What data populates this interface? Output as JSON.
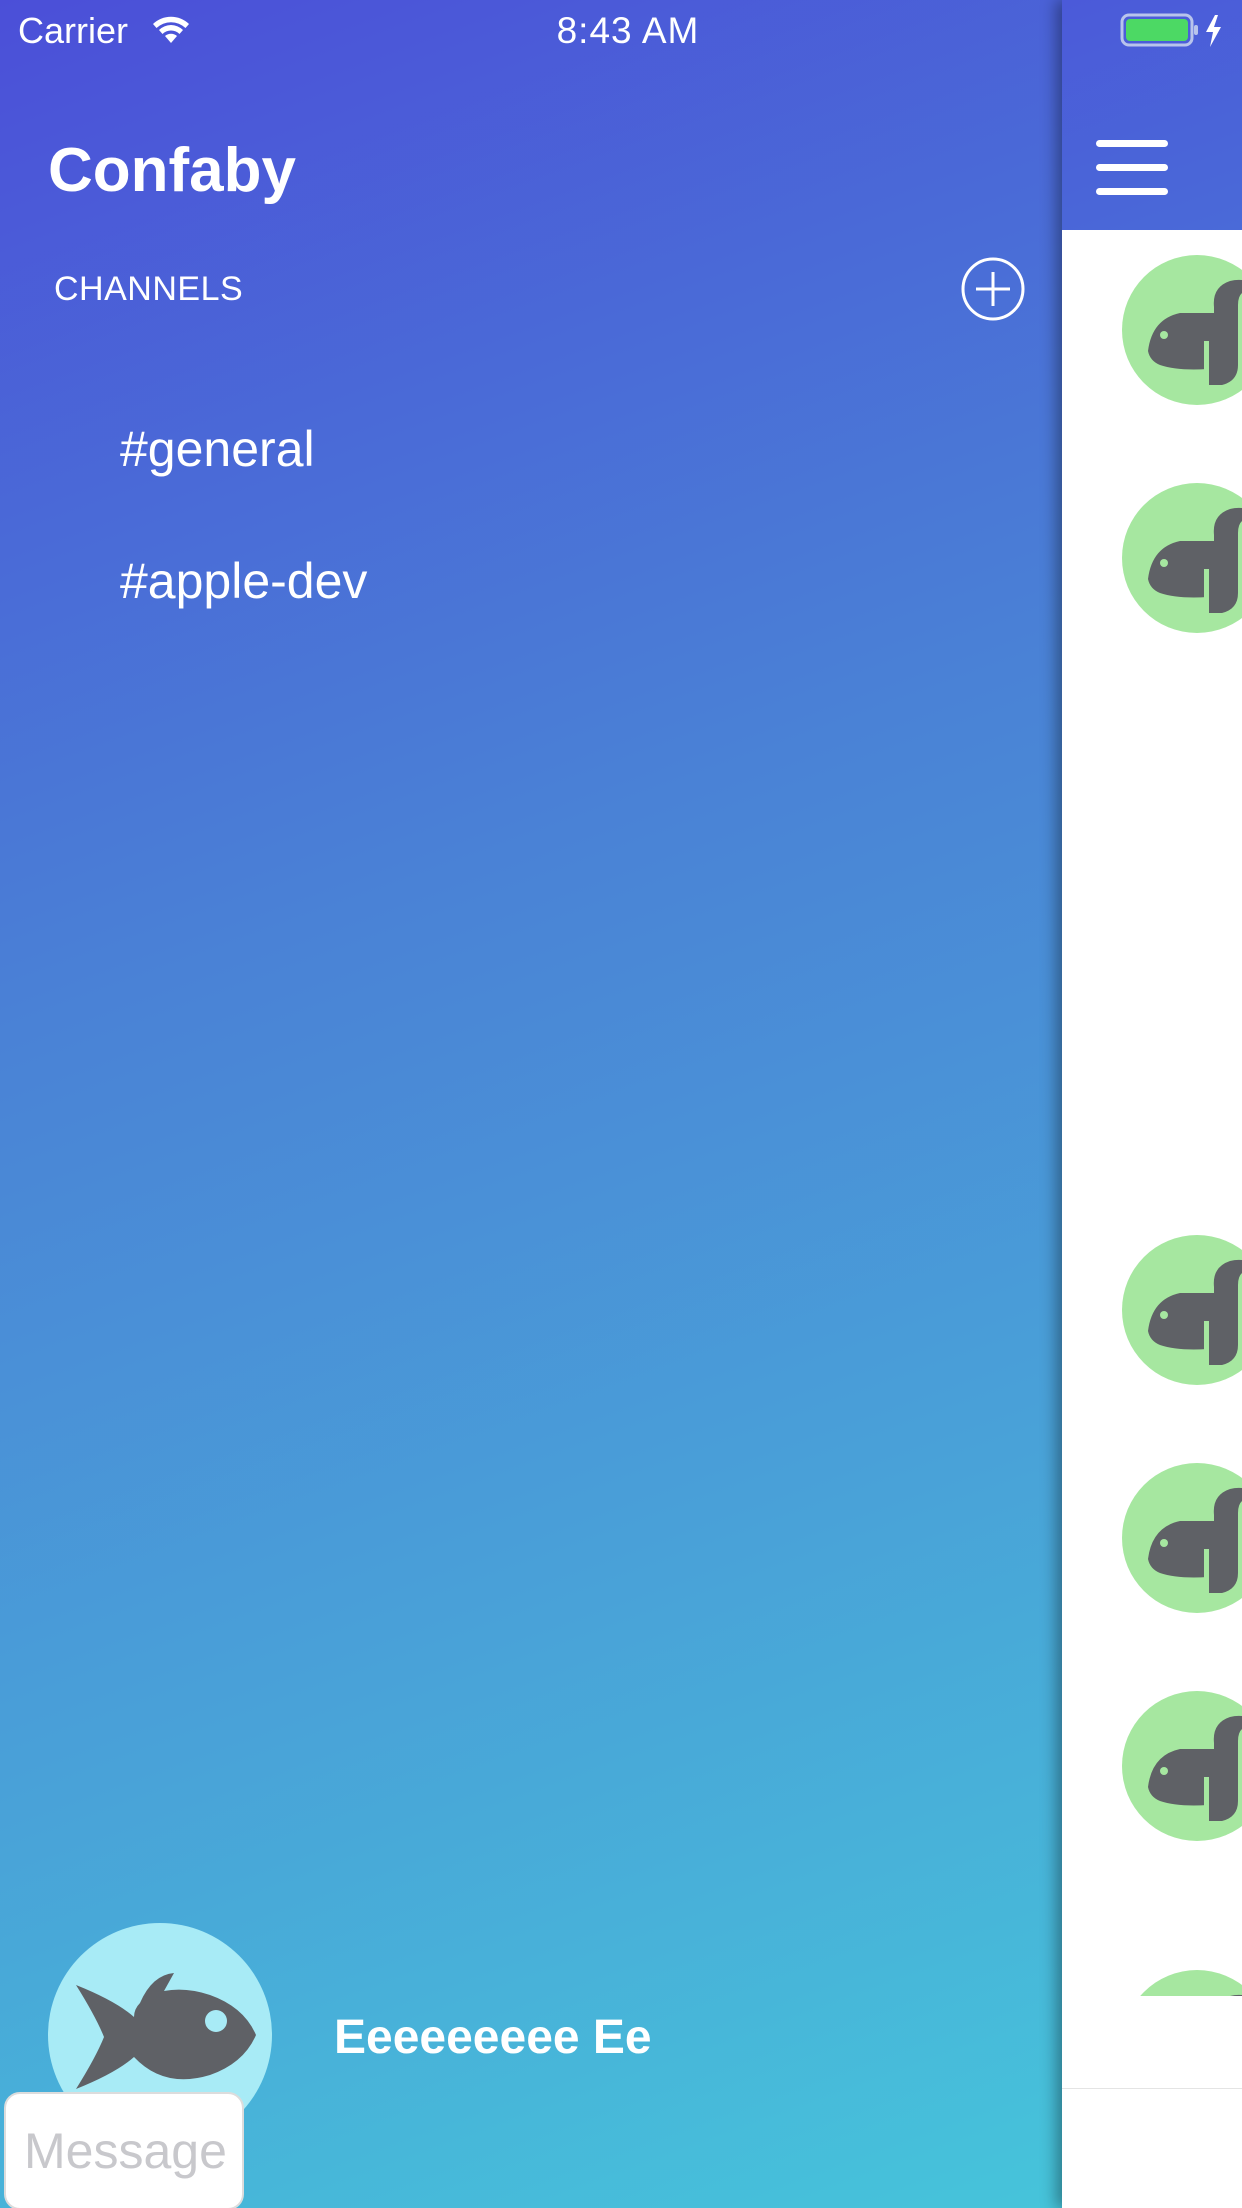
{
  "status_bar": {
    "carrier": "Carrier",
    "time": "8:43 AM",
    "battery_color": "#4cd964"
  },
  "drawer": {
    "app_title": "Confaby",
    "channels_header": "CHANNELS",
    "add_channel_icon": "plus-circle-icon",
    "channels": [
      {
        "label": "#general"
      },
      {
        "label": "#apple-dev"
      }
    ],
    "user": {
      "name": "Eeeeeeeee Ee",
      "avatar_icon": "fish-icon",
      "avatar_bg": "#a8ebf6"
    },
    "gradient": [
      "#4b4fd8",
      "#46c4da"
    ]
  },
  "main": {
    "menu_icon": "hamburger-menu-icon",
    "message_avatars": [
      {
        "icon": "whale-icon",
        "bg": "#a6e7a0"
      },
      {
        "icon": "whale-icon",
        "bg": "#a6e7a0"
      },
      {
        "icon": "whale-icon",
        "bg": "#a6e7a0"
      },
      {
        "icon": "whale-icon",
        "bg": "#a6e7a0"
      },
      {
        "icon": "whale-icon",
        "bg": "#a6e7a0"
      },
      {
        "icon": "whale-icon",
        "bg": "#a6e7a0"
      }
    ],
    "message_input": {
      "placeholder": "Message",
      "value": ""
    }
  }
}
